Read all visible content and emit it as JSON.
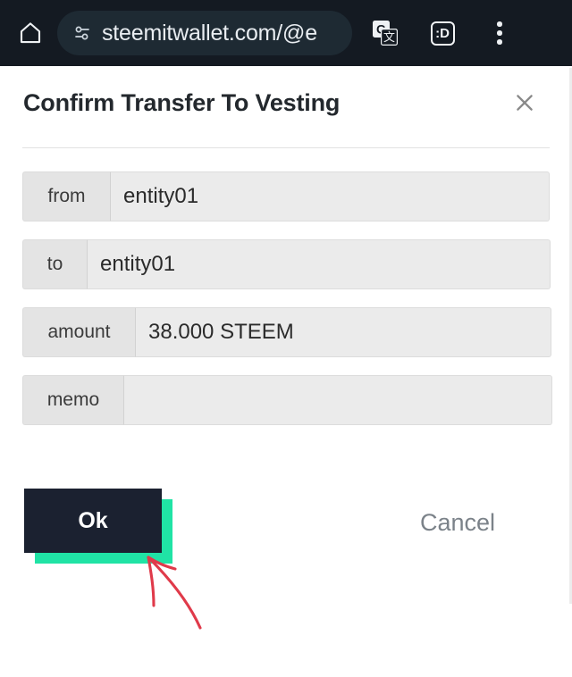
{
  "browser": {
    "home_icon": "home-icon",
    "permission_icon": "tune-sliders-icon",
    "url": "steemitwallet.com/@e",
    "translate_icon": "google-translate-icon",
    "tab_count_label": ":D",
    "menu_icon": "three-dot-menu-icon",
    "bar_background": "#141a22",
    "omnibox_background": "#1e2a33"
  },
  "dialog": {
    "title": "Confirm Transfer To Vesting",
    "close_icon": "close-icon",
    "fields": [
      {
        "label": "from",
        "value": "entity01"
      },
      {
        "label": "to",
        "value": "entity01"
      },
      {
        "label": "amount",
        "value": "38.000 STEEM"
      },
      {
        "label": "memo",
        "value": ""
      }
    ],
    "ok_label": "Ok",
    "cancel_label": "Cancel",
    "ok_color": "#1b2130",
    "ok_shadow_color": "#20e3a5",
    "cancel_color": "#7b8289"
  },
  "annotation": {
    "arrow_color": "#e03a4a",
    "arrow_name": "red-arrow-pointing-to-ok-button"
  }
}
